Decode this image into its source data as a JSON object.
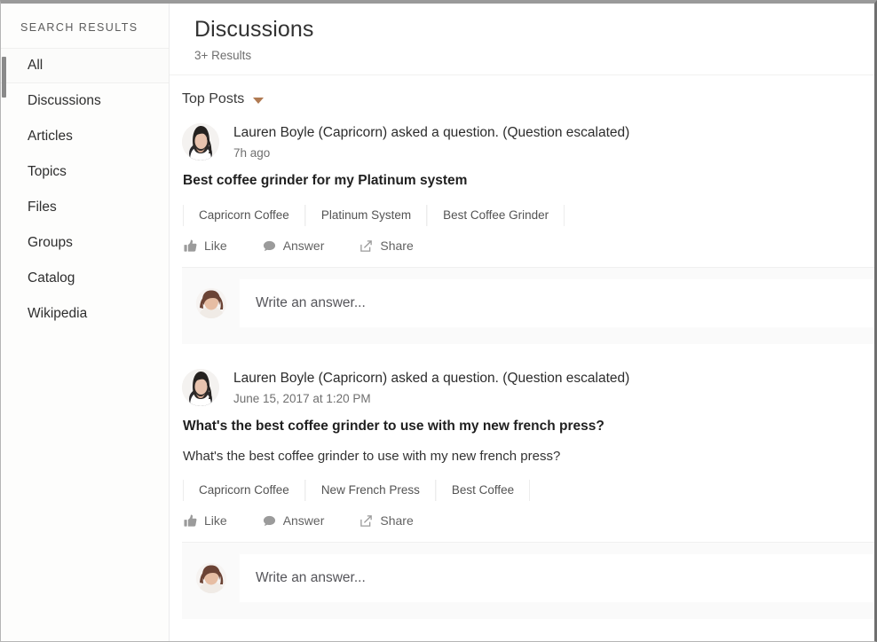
{
  "sidebar": {
    "title": "SEARCH RESULTS",
    "items": [
      {
        "label": "All",
        "active": true
      },
      {
        "label": "Discussions",
        "active": false
      },
      {
        "label": "Articles",
        "active": false
      },
      {
        "label": "Topics",
        "active": false
      },
      {
        "label": "Files",
        "active": false
      },
      {
        "label": "Groups",
        "active": false
      },
      {
        "label": "Catalog",
        "active": false
      },
      {
        "label": "Wikipedia",
        "active": false
      }
    ]
  },
  "header": {
    "title": "Discussions",
    "results_count": "3+ Results"
  },
  "sort": {
    "label": "Top Posts",
    "caret_icon": "chevron-down-icon",
    "caret_color": "#b07a52"
  },
  "actions": {
    "like": "Like",
    "answer": "Answer",
    "share": "Share",
    "like_icon": "thumbs-up-icon",
    "answer_icon": "comment-bubble-icon",
    "share_icon": "share-arrow-icon"
  },
  "composer": {
    "placeholder": "Write an answer...",
    "avatar_icon": "user-avatar"
  },
  "posts": [
    {
      "byline": "Lauren Boyle (Capricorn) asked a question. (Question escalated)",
      "time": "7h ago",
      "title": "Best coffee grinder for my Platinum system",
      "body": "",
      "tags": [
        "Capricorn Coffee",
        "Platinum System",
        "Best Coffee Grinder"
      ]
    },
    {
      "byline": "Lauren Boyle (Capricorn) asked a question. (Question escalated)",
      "time": "June 15, 2017 at 1:20 PM",
      "title": "What's the best coffee grinder to use with my new french press?",
      "body": "What's the best coffee grinder to use with my new french press?",
      "tags": [
        "Capricorn Coffee",
        "New French Press",
        "Best Coffee"
      ]
    }
  ]
}
